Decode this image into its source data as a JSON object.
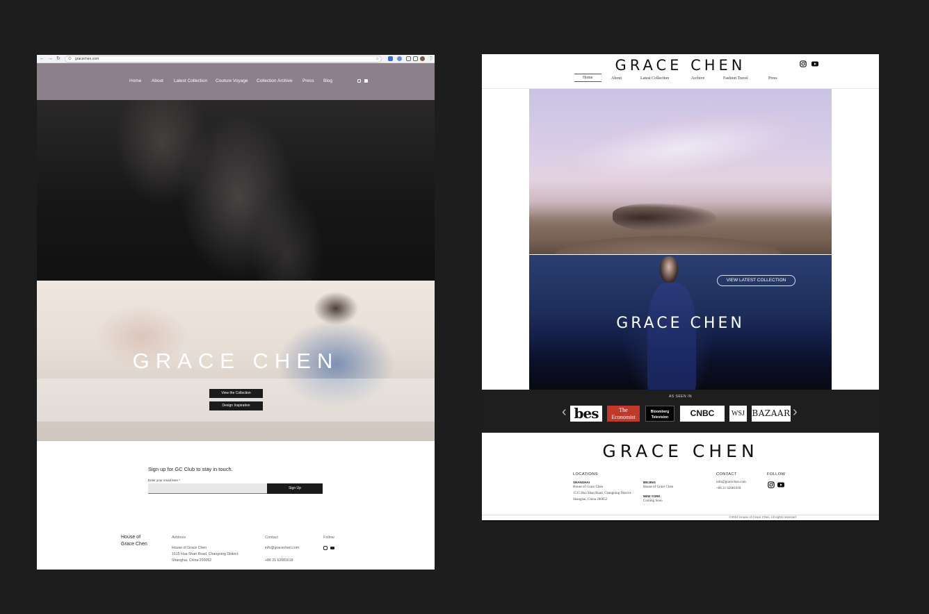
{
  "left": {
    "browser": {
      "url": "gracechen.com",
      "nav_back": "←",
      "nav_forward": "→",
      "nav_reload": "↻",
      "star": "☆"
    },
    "nav": {
      "items": [
        "Home",
        "About",
        "Latest Collection",
        "Couture Voyage",
        "Collection Archive",
        "Press",
        "Blog"
      ],
      "social": [
        "instagram-icon",
        "youtube-icon"
      ]
    },
    "hero": {
      "title": "GRACE CHEN",
      "buttons": [
        "View the Collection",
        "Design Inspiration"
      ]
    },
    "signup": {
      "heading": "Sign up for GC Club to stay in touch.",
      "label": "Enter your email here *",
      "input_value": "",
      "button": "Sign Up"
    },
    "footer": {
      "brand_line1": "House of",
      "brand_line2": "Grace Chen",
      "address_heading": "Address",
      "address_lines": [
        "House of Grace Chen",
        "1515 Hua Shan Road, Changning District",
        "Shanghai, China 200052"
      ],
      "contact_heading": "Contact",
      "email": "info@gracechen.com",
      "phone": "+86 21 62081618",
      "follow_heading": "Follow"
    }
  },
  "right": {
    "logo": "GRACE CHEN",
    "nav": {
      "items": [
        "Home",
        "About",
        "Latest Collection",
        "Archive",
        "Fashion Travel",
        "Press"
      ],
      "active": "Home"
    },
    "hero2": {
      "title": "GRACE CHEN",
      "cta": "VIEW LATEST COLLECTION"
    },
    "press": {
      "title": "AS SEEN IN",
      "prev": "‹",
      "next": "›",
      "logos": [
        "bes",
        "The Economist",
        "Bloomberg Television",
        "CNBC",
        "WSJ",
        "BAZAAR"
      ]
    },
    "footer": {
      "logo": "GRACE CHEN",
      "locations_heading": "LOCATIONS",
      "shanghai_label": "SHANGHAI",
      "shanghai_lines": [
        "House of Grace Chen",
        "1515 Hua Shan Road, Changning District",
        "Shanghai, China 200052"
      ],
      "beijing_label": "BEIJING",
      "beijing_line": "House of Grace Chen",
      "newyork_label": "NEW YORK",
      "newyork_line": "Coming Soon",
      "contact_heading": "CONTACT",
      "email": "info@gracechen.com",
      "phone": "+86 21 62081618",
      "follow_heading": "FOLLOW",
      "copyright": "©2024 House of Grace Chen. All rights reserved."
    }
  },
  "colors": {
    "page_bg": "#1d1d1d",
    "old_nav_bg": "#8d7f8b",
    "button_bg": "#1b1b1b",
    "press_band_bg": "#1e1e1e",
    "economist_red": "#c0392b"
  }
}
